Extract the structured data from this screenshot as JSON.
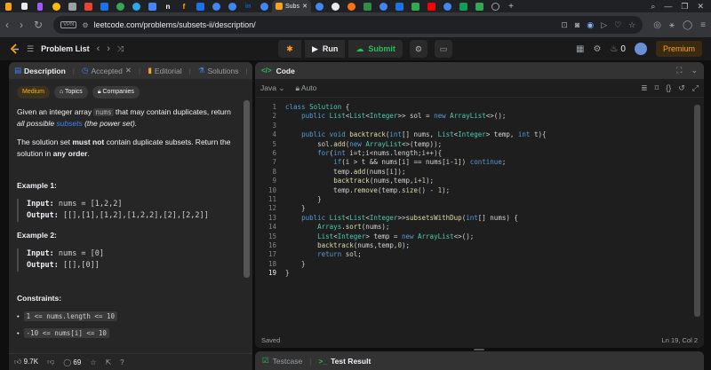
{
  "browser": {
    "active_tab_title": "Subs",
    "tab_close": "✕",
    "url": "leetcode.com/problems/subsets-ii/description/",
    "vpn_label": "VPN",
    "extension_letter_n": "n",
    "extension_letter_f": "f",
    "extension_letter_in": "in"
  },
  "header": {
    "problem_list_label": "Problem List",
    "run_label": "Run",
    "submit_label": "Submit",
    "streak_count": "0",
    "premium_label": "Premium"
  },
  "left_tabs": {
    "description": "Description",
    "accepted": "Accepted",
    "editorial": "Editorial",
    "solutions": "Solutions"
  },
  "problem": {
    "difficulty": "Medium",
    "topics_label": "Topics",
    "companies_label": "Companies",
    "desc_1a": "Given an integer array ",
    "desc_1_code": "nums",
    "desc_1b": " that may contain duplicates, return ",
    "desc_1c": "all possible ",
    "desc_1_link": "subsets",
    "desc_1d": " (the power set).",
    "desc_2a": "The solution set ",
    "desc_2_bold": "must not",
    "desc_2b": " contain duplicate subsets. Return the solution in ",
    "desc_2_bold2": "any order",
    "desc_2c": ".",
    "example1_title": "Example 1:",
    "example1_input_label": "Input:",
    "example1_input": "nums = [1,2,2]",
    "example1_output_label": "Output:",
    "example1_output": "[[],[1],[1,2],[1,2,2],[2],[2,2]]",
    "example2_title": "Example 2:",
    "example2_input_label": "Input:",
    "example2_input": "nums = [0]",
    "example2_output_label": "Output:",
    "example2_output": "[[],[0]]",
    "constraints_title": "Constraints:",
    "constraint_1": "1 <= nums.length <= 10",
    "constraint_2": "-10 <= nums[i] <= 10"
  },
  "left_footer": {
    "likes": "9.7K",
    "comments": "69"
  },
  "code_panel": {
    "title": "Code",
    "language": "Java",
    "auto_label": "Auto",
    "status_saved": "Saved",
    "cursor_position": "Ln 19, Col 2"
  },
  "code_lines": [
    "class Solution {",
    "    public List<List<Integer>> sol = new ArrayList<>();",
    "",
    "    public void backtrack(int[] nums, List<Integer> temp, int t){",
    "        sol.add(new ArrayList<>(temp));",
    "        for(int i=t;i<nums.length;i++){",
    "            if(i > t && nums[i] == nums[i-1]) continue;",
    "            temp.add(nums[i]);",
    "            backtrack(nums,temp,i+1);",
    "            temp.remove(temp.size() - 1);",
    "        }",
    "    }",
    "    public List<List<Integer>>subsetsWithDup(int[] nums) {",
    "        Arrays.sort(nums);",
    "        List<Integer> temp = new ArrayList<>();",
    "        backtrack(nums,temp,0);",
    "        return sol;",
    "    }",
    "}"
  ],
  "bottom_tabs": {
    "testcase": "Testcase",
    "test_result": "Test Result"
  },
  "colors": {
    "accent_orange": "#ffa116",
    "green": "#2cbb5d",
    "medium": "#ffb800",
    "link_blue": "#3b82f6"
  }
}
